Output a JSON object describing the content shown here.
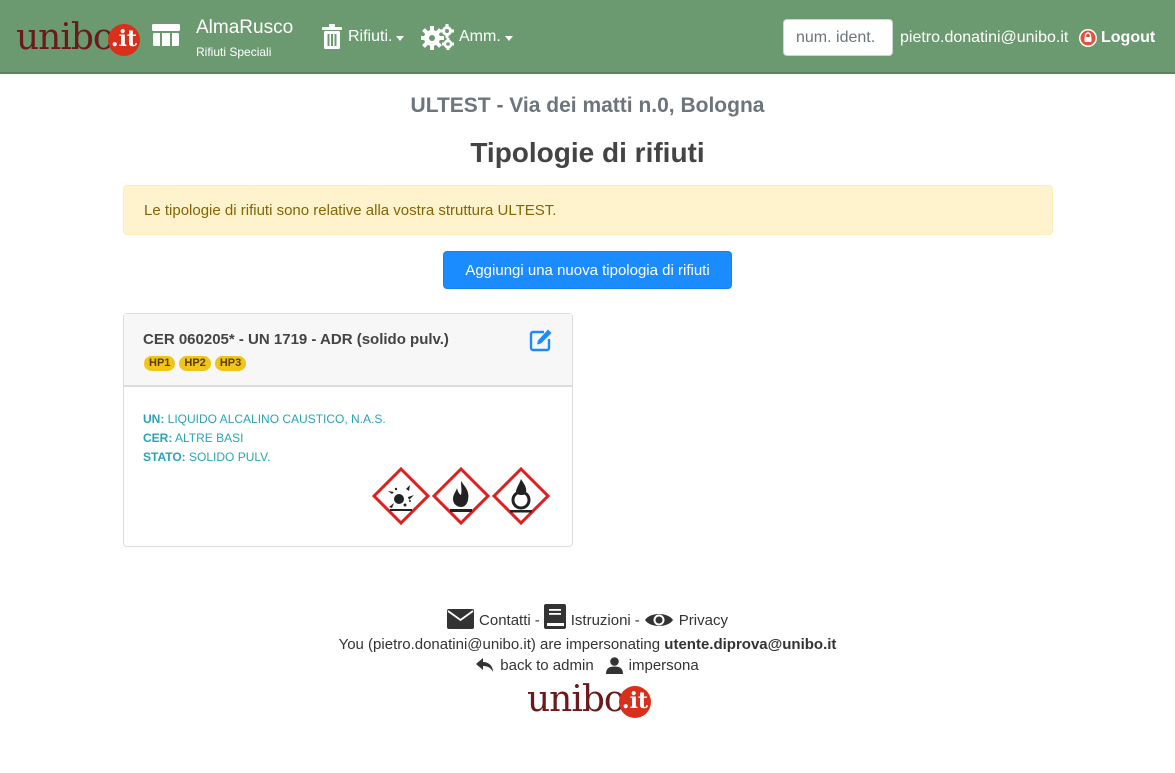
{
  "navbar": {
    "logo_text": "unibo",
    "logo_suffix": ".it",
    "brand_title": "AlmaRusco",
    "brand_subtitle": "Rifiuti Speciali",
    "menu_rifiuti": "Rifiuti.",
    "menu_amm": "Amm.",
    "search_placeholder": "num. ident.",
    "user_email": "pietro.donatini@unibo.it",
    "logout_label": "Logout",
    "bg_color": "#6c9a70"
  },
  "main": {
    "structure_title": "ULTEST - Via dei matti n.0, Bologna",
    "page_title": "Tipologie di rifiuti",
    "alert_text": "Le tipologie di rifiuti sono relative alla vostra struttura ULTEST.",
    "add_button": "Aggiungi una nuova tipologia di rifiuti"
  },
  "cards": [
    {
      "title": "CER 060205* - UN 1719 - ADR (solido pulv.)",
      "badges": [
        "HP1",
        "HP2",
        "HP3"
      ],
      "un_label": "UN:",
      "un_value": "LIQUIDO ALCALINO CAUSTICO, N.A.S.",
      "cer_label": "CER:",
      "cer_value": "ALTRE BASI",
      "stato_label": "STATO:",
      "stato_value": "SOLIDO PULV.",
      "pictograms": [
        "explosive-icon",
        "flammable-icon",
        "oxidizing-icon"
      ]
    }
  ],
  "footer": {
    "contatti": "Contatti",
    "istruzioni": "Istruzioni",
    "privacy": "Privacy",
    "separator": "-",
    "impersonate_prefix": "You (pietro.donatini@unibo.it) are impersonating",
    "impersonated_user": "utente.diprova@unibo.it",
    "back_to_admin": "back to admin",
    "impersona": "impersona"
  }
}
